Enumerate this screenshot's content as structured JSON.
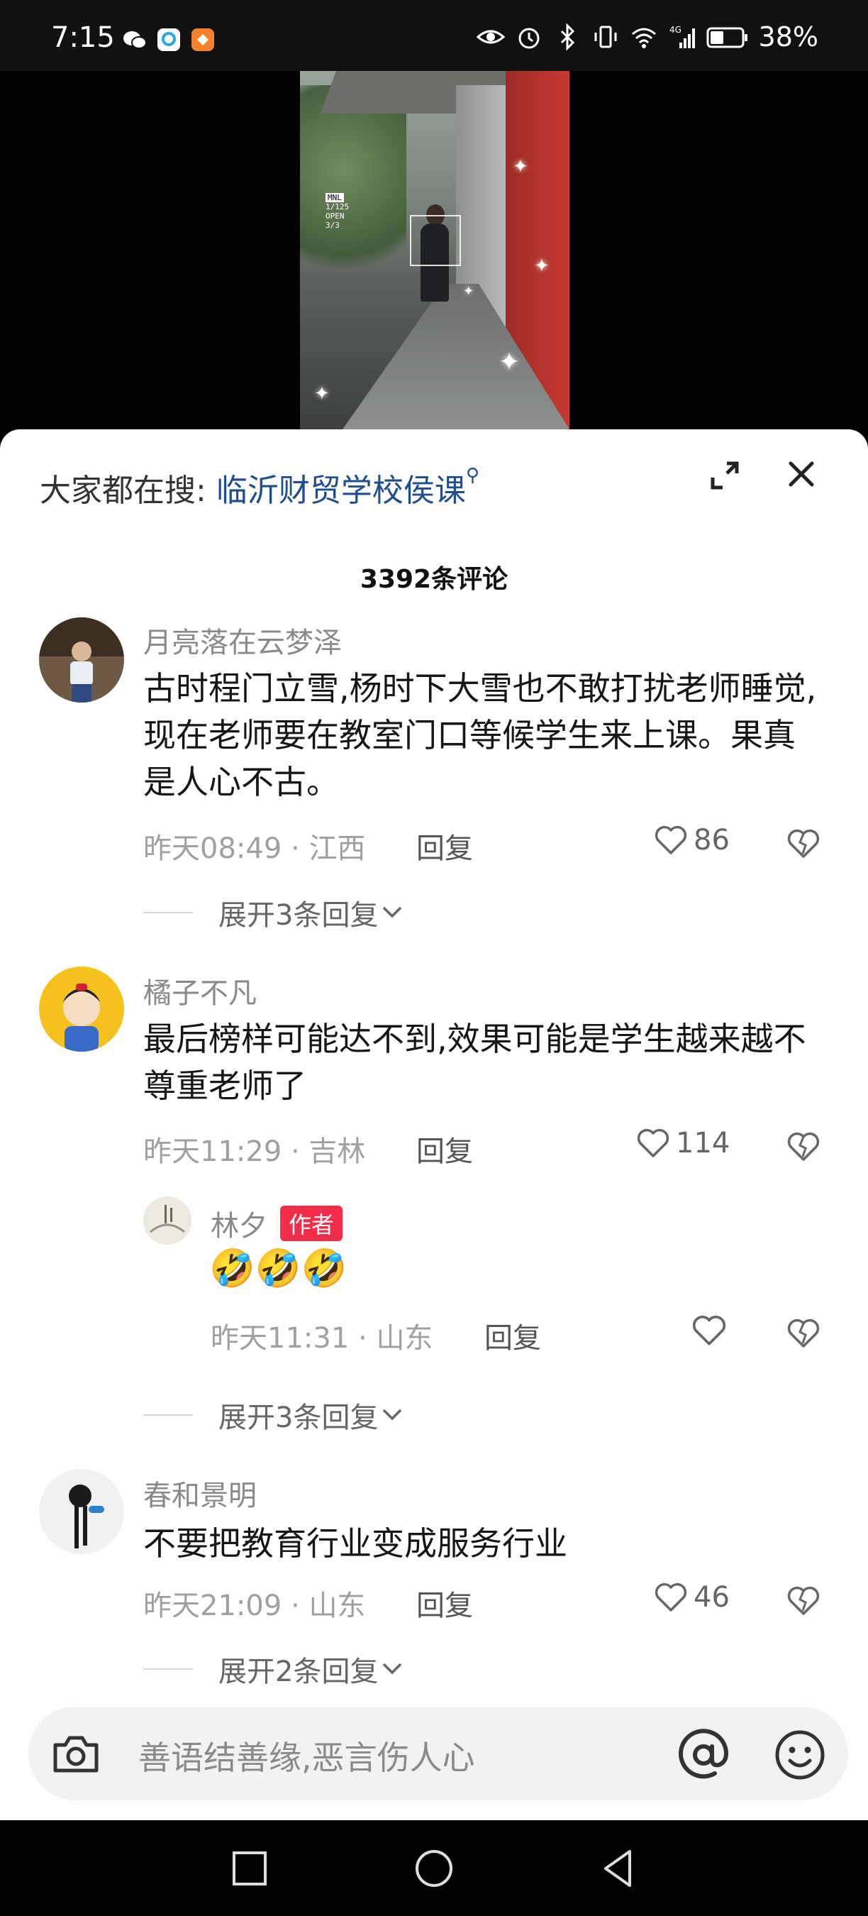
{
  "status_bar": {
    "time": "7:15",
    "battery": "38%",
    "network": "4G"
  },
  "comment_sheet": {
    "search_label": "大家都在搜:",
    "search_query": "临沂财贸学校侯课",
    "comment_count": "3392条评论",
    "comments": [
      {
        "user": "月亮落在云梦泽",
        "text": "古时程门立雪,杨时下大雪也不敢打扰老师睡觉,现在老师要在教室门口等候学生来上课。果真是人心不古。",
        "time": "昨天08:49",
        "location": "江西",
        "reply_label": "回复",
        "likes": "86",
        "expand": "展开3条回复"
      },
      {
        "user": "橘子不凡",
        "text": "最后榜样可能达不到,效果可能是学生越来越不尊重老师了",
        "time": "昨天11:29",
        "location": "吉林",
        "reply_label": "回复",
        "likes": "114",
        "reply": {
          "user": "林夕",
          "badge": "作者",
          "text": "🤣🤣🤣",
          "time": "昨天11:31",
          "location": "山东",
          "reply_label": "回复"
        },
        "expand": "展开3条回复"
      },
      {
        "user": "春和景明",
        "text": "不要把教育行业变成服务行业",
        "time": "昨天21:09",
        "location": "山东",
        "reply_label": "回复",
        "likes": "46",
        "expand": "展开2条回复"
      }
    ]
  },
  "input": {
    "placeholder": "善语结善缘,恶言伤人心"
  },
  "video_overlay": {
    "mode": "MNL",
    "shutter": "1/125",
    "aperture": "OPEN",
    "iso": "3/3"
  },
  "colors": {
    "link": "#1f4e8c",
    "author_badge": "#f22c49"
  }
}
